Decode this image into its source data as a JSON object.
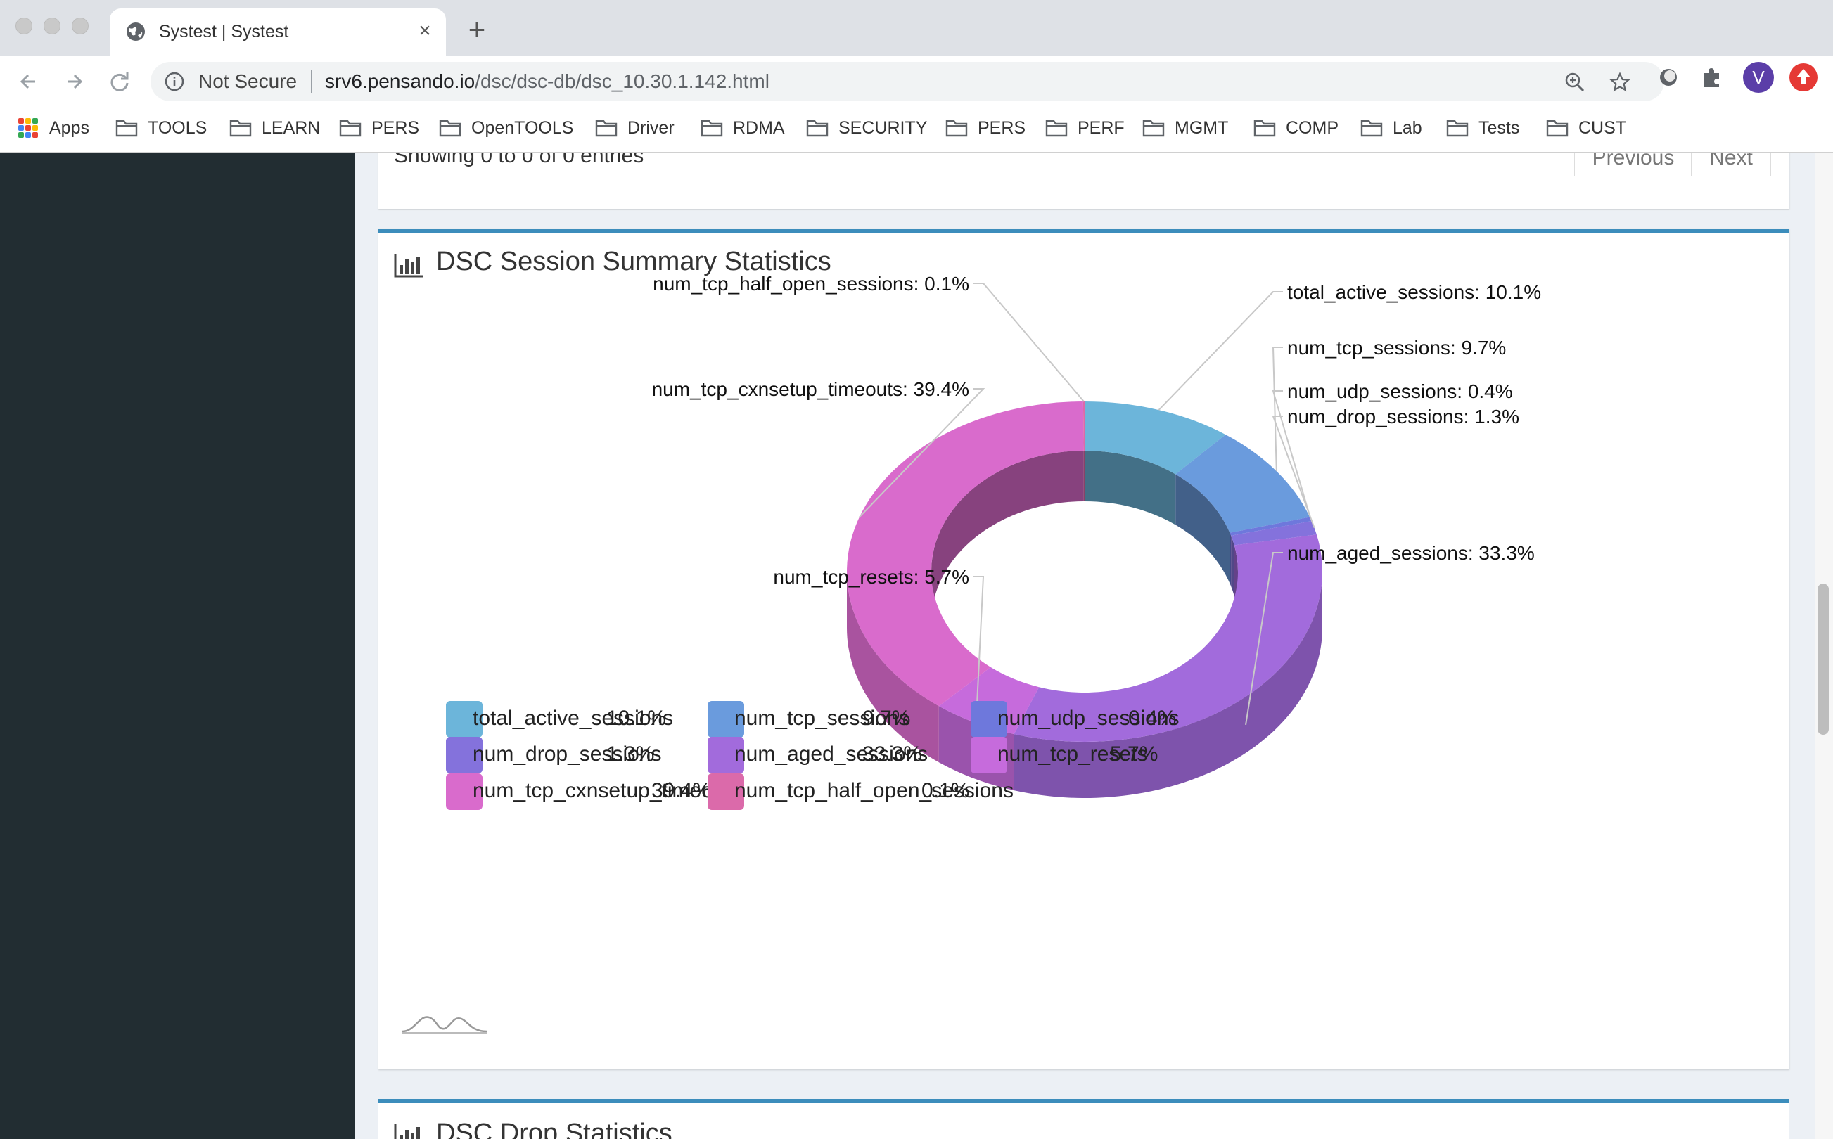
{
  "browser": {
    "tab_title": "Systest | Systest",
    "tab_close": "×",
    "new_tab": "+",
    "security_label": "Not Secure",
    "url_host": "srv6.pensando.io",
    "url_path": "/dsc/dsc-db/dsc_10.30.1.142.html",
    "profile_initial": "V",
    "bookmarks": [
      "Apps",
      "TOOLS",
      "LEARN",
      "PERS",
      "OpenTOOLS",
      "Driver",
      "RDMA",
      "SECURITY",
      "PERS",
      "PERF",
      "MGMT",
      "COMP",
      "Lab",
      "Tests",
      "CUST"
    ]
  },
  "table_footer": {
    "showing": "Showing 0 to 0 of 0 entries",
    "previous": "Previous",
    "next": "Next"
  },
  "panel": {
    "title": "DSC Session Summary Statistics",
    "next_title": "DSC Drop Statistics"
  },
  "chart_data": {
    "type": "pie",
    "variant": "3d-donut",
    "title": "DSC Session Summary Statistics",
    "series": [
      {
        "name": "total_active_sessions",
        "value": 10.1,
        "label": "total_active_sessions: 10.1%",
        "pct": "10.1%",
        "color": "#6cb5da"
      },
      {
        "name": "num_tcp_sessions",
        "value": 9.7,
        "label": "num_tcp_sessions: 9.7%",
        "pct": "9.7%",
        "color": "#6a9bdd"
      },
      {
        "name": "num_udp_sessions",
        "value": 0.4,
        "label": "num_udp_sessions: 0.4%",
        "pct": "0.4%",
        "color": "#6e78dc"
      },
      {
        "name": "num_drop_sessions",
        "value": 1.3,
        "label": "num_drop_sessions: 1.3%",
        "pct": "1.3%",
        "color": "#8472dc"
      },
      {
        "name": "num_aged_sessions",
        "value": 33.3,
        "label": "num_aged_sessions: 33.3%",
        "pct": "33.3%",
        "color": "#a26bdc"
      },
      {
        "name": "num_tcp_resets",
        "value": 5.7,
        "label": "num_tcp_resets: 5.7%",
        "pct": "5.7%",
        "color": "#c66bdc"
      },
      {
        "name": "num_tcp_cxnsetup_timeouts",
        "value": 39.4,
        "label": "num_tcp_cxnsetup_timeouts: 39.4%",
        "pct": "39.4%",
        "color": "#d96bcc"
      },
      {
        "name": "num_tcp_half_open_sessions",
        "value": 0.1,
        "label": "num_tcp_half_open_sessions: 0.1%",
        "pct": "0.1%",
        "color": "#db6aaa"
      }
    ],
    "legend_position": "bottom"
  }
}
